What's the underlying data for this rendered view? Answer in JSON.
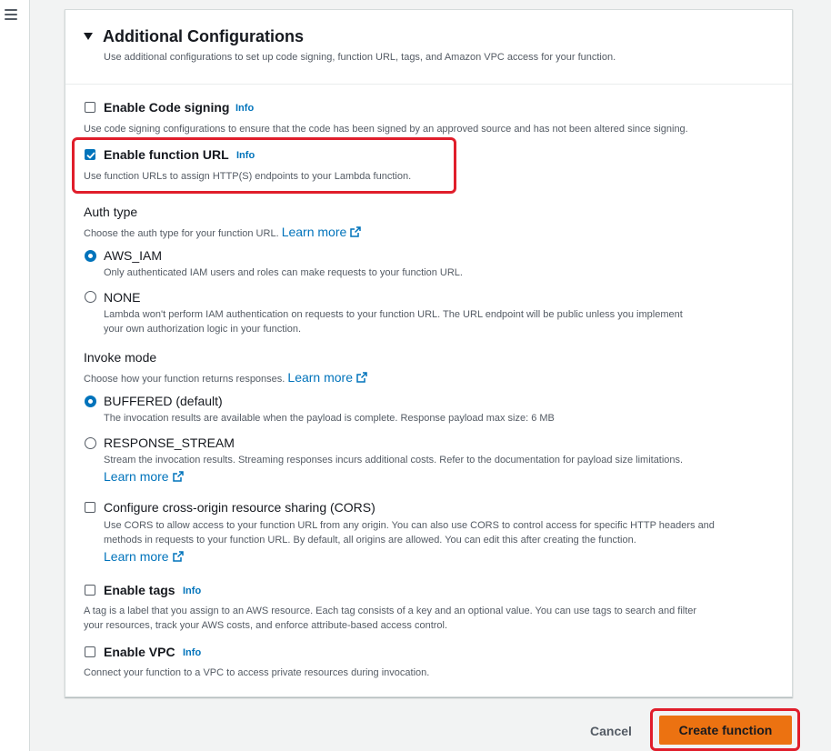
{
  "nav": {
    "menu_icon": "hamburger-icon"
  },
  "section": {
    "title": "Additional Configurations",
    "description": "Use additional configurations to set up code signing, function URL, tags, and Amazon VPC access for your function."
  },
  "code_signing": {
    "label": "Enable Code signing",
    "info": "Info",
    "checked": false,
    "description": "Use code signing configurations to ensure that the code has been signed by an approved source and has not been altered since signing."
  },
  "function_url": {
    "label": "Enable function URL",
    "info": "Info",
    "checked": true,
    "description": "Use function URLs to assign HTTP(S) endpoints to your Lambda function."
  },
  "auth_type": {
    "label": "Auth type",
    "description": "Choose the auth type for your function URL.",
    "learn_more": "Learn more",
    "options": [
      {
        "label": "AWS_IAM",
        "selected": true,
        "description": "Only authenticated IAM users and roles can make requests to your function URL."
      },
      {
        "label": "NONE",
        "selected": false,
        "description_line1": "Lambda won't perform IAM authentication on requests to your function URL. The URL endpoint will be public unless you implement",
        "description_line2": "your own authorization logic in your function."
      }
    ]
  },
  "invoke_mode": {
    "label": "Invoke mode",
    "description": "Choose how your function returns responses.",
    "learn_more": "Learn more",
    "options": [
      {
        "label": "BUFFERED (default)",
        "selected": true,
        "description": "The invocation results are available when the payload is complete. Response payload max size: 6 MB"
      },
      {
        "label": "RESPONSE_STREAM",
        "selected": false,
        "description": "Stream the invocation results. Streaming responses incurs additional costs. Refer to the documentation for payload size limitations.",
        "learn_more": "Learn more"
      }
    ]
  },
  "cors": {
    "label": "Configure cross-origin resource sharing (CORS)",
    "checked": false,
    "description_line1": "Use CORS to allow access to your function URL from any origin. You can also use CORS to control access for specific HTTP headers and",
    "description_line2": "methods in requests to your function URL. By default, all origins are allowed. You can edit this after creating the function.",
    "learn_more": "Learn more"
  },
  "tags": {
    "label": "Enable tags",
    "info": "Info",
    "checked": false,
    "description_line1": "A tag is a label that you assign to an AWS resource. Each tag consists of a key and an optional value. You can use tags to search and filter",
    "description_line2": "your resources, track your AWS costs, and enforce attribute-based access control."
  },
  "vpc": {
    "label": "Enable VPC",
    "info": "Info",
    "checked": false,
    "description": "Connect your function to a VPC to access private resources during invocation."
  },
  "footer": {
    "cancel": "Cancel",
    "create": "Create function"
  },
  "colors": {
    "accent": "#0073bb",
    "primary_button": "#ec7211",
    "highlight": "#e01e2b"
  }
}
